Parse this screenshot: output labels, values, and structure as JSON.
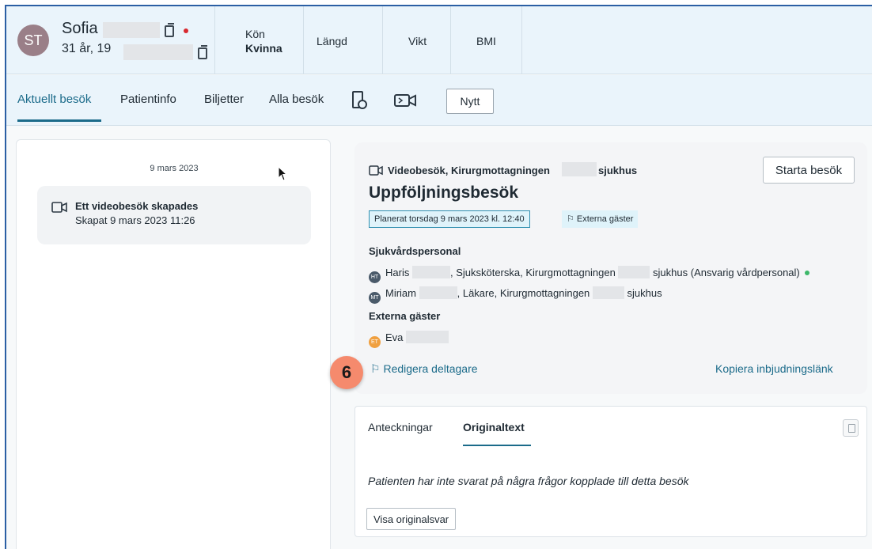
{
  "header": {
    "avatar_initials": "ST",
    "patient_first_name": "Sofia",
    "patient_age": "31 år, 19",
    "stats": [
      {
        "label": "Kön",
        "value": "Kvinna"
      },
      {
        "label": "Längd",
        "value": ""
      },
      {
        "label": "Vikt",
        "value": ""
      },
      {
        "label": "BMI",
        "value": ""
      }
    ]
  },
  "tabs": {
    "items": [
      "Aktuellt besök",
      "Patientinfo",
      "Biljetter",
      "Alla besök"
    ],
    "active": "Aktuellt besök",
    "new_button": "Nytt"
  },
  "timeline": {
    "date": "9 mars 2023",
    "event_title": "Ett videobesök skapades",
    "event_sub": "Skapat 9 mars 2023 11:26"
  },
  "visit": {
    "type_prefix": "Videobesök, Kirurgmottagningen",
    "type_suffix": "sjukhus",
    "title": "Uppföljningsbesök",
    "planned": "Planerat torsdag 9 mars 2023 kl. 12:40",
    "external_badge": "Externa gäster",
    "start_button": "Starta besök",
    "staff_heading": "Sjukvårdspersonal",
    "staff": [
      {
        "initials": "HT",
        "name": "Haris",
        "role": ", Sjuksköterska, Kirurgmottagningen",
        "suffix": "sjukhus (Ansvarig vårdpersonal)",
        "color": "#4a5a6a"
      },
      {
        "initials": "MT",
        "name": "Miriam",
        "role": ", Läkare, Kirurgmottagningen",
        "suffix": "sjukhus",
        "color": "#4a5a6a"
      }
    ],
    "guests_heading": "Externa gäster",
    "guests": [
      {
        "initials": "ET",
        "name": "Eva",
        "color": "#f0a040"
      }
    ],
    "edit_link": "Redigera deltagare",
    "copy_link": "Kopiera inbjudningslänk",
    "step_number": "6"
  },
  "notes": {
    "tabs": [
      "Anteckningar",
      "Originaltext"
    ],
    "active": "Originaltext",
    "empty_text": "Patienten har inte svarat på några frågor kopplade till detta besök",
    "show_button": "Visa originalsvar"
  },
  "colors": {
    "accent": "#1b6b8a",
    "header_bg": "#eaf4fb",
    "online_dot": "#3db86a",
    "alert_dot": "#d8292f",
    "step_badge": "#f58a6d"
  }
}
